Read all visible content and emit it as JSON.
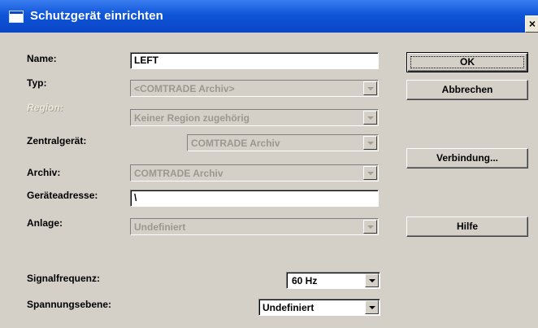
{
  "window": {
    "title": "Schutzgerät einrichten",
    "close_glyph": "×"
  },
  "fields": {
    "name": {
      "label": "Name:",
      "value": "LEFT"
    },
    "typ": {
      "label": "Typ:",
      "value": "<COMTRADE Archiv>"
    },
    "region": {
      "label": "Region:",
      "value": "Keiner Region zugehörig"
    },
    "zentralgeraet": {
      "label": "Zentralgerät:",
      "value": "COMTRADE Archiv"
    },
    "archiv": {
      "label": "Archiv:",
      "value": "COMTRADE Archiv"
    },
    "geraeteadresse": {
      "label": "Geräteadresse:",
      "value": "\\"
    },
    "anlage": {
      "label": "Anlage:",
      "value": "Undefiniert"
    },
    "signalfrequenz": {
      "label": "Signalfrequenz:",
      "value": "60 Hz"
    },
    "spannungsebene": {
      "label": "Spannungsebene:",
      "value": "Undefiniert"
    }
  },
  "buttons": {
    "ok": "OK",
    "abbrechen": "Abbrechen",
    "verbindung": "Verbindung...",
    "hilfe": "Hilfe"
  },
  "colors": {
    "titlebar": "#0a46c6",
    "dialog_face": "#d4d0c8",
    "disabled_text": "#9b9890"
  }
}
